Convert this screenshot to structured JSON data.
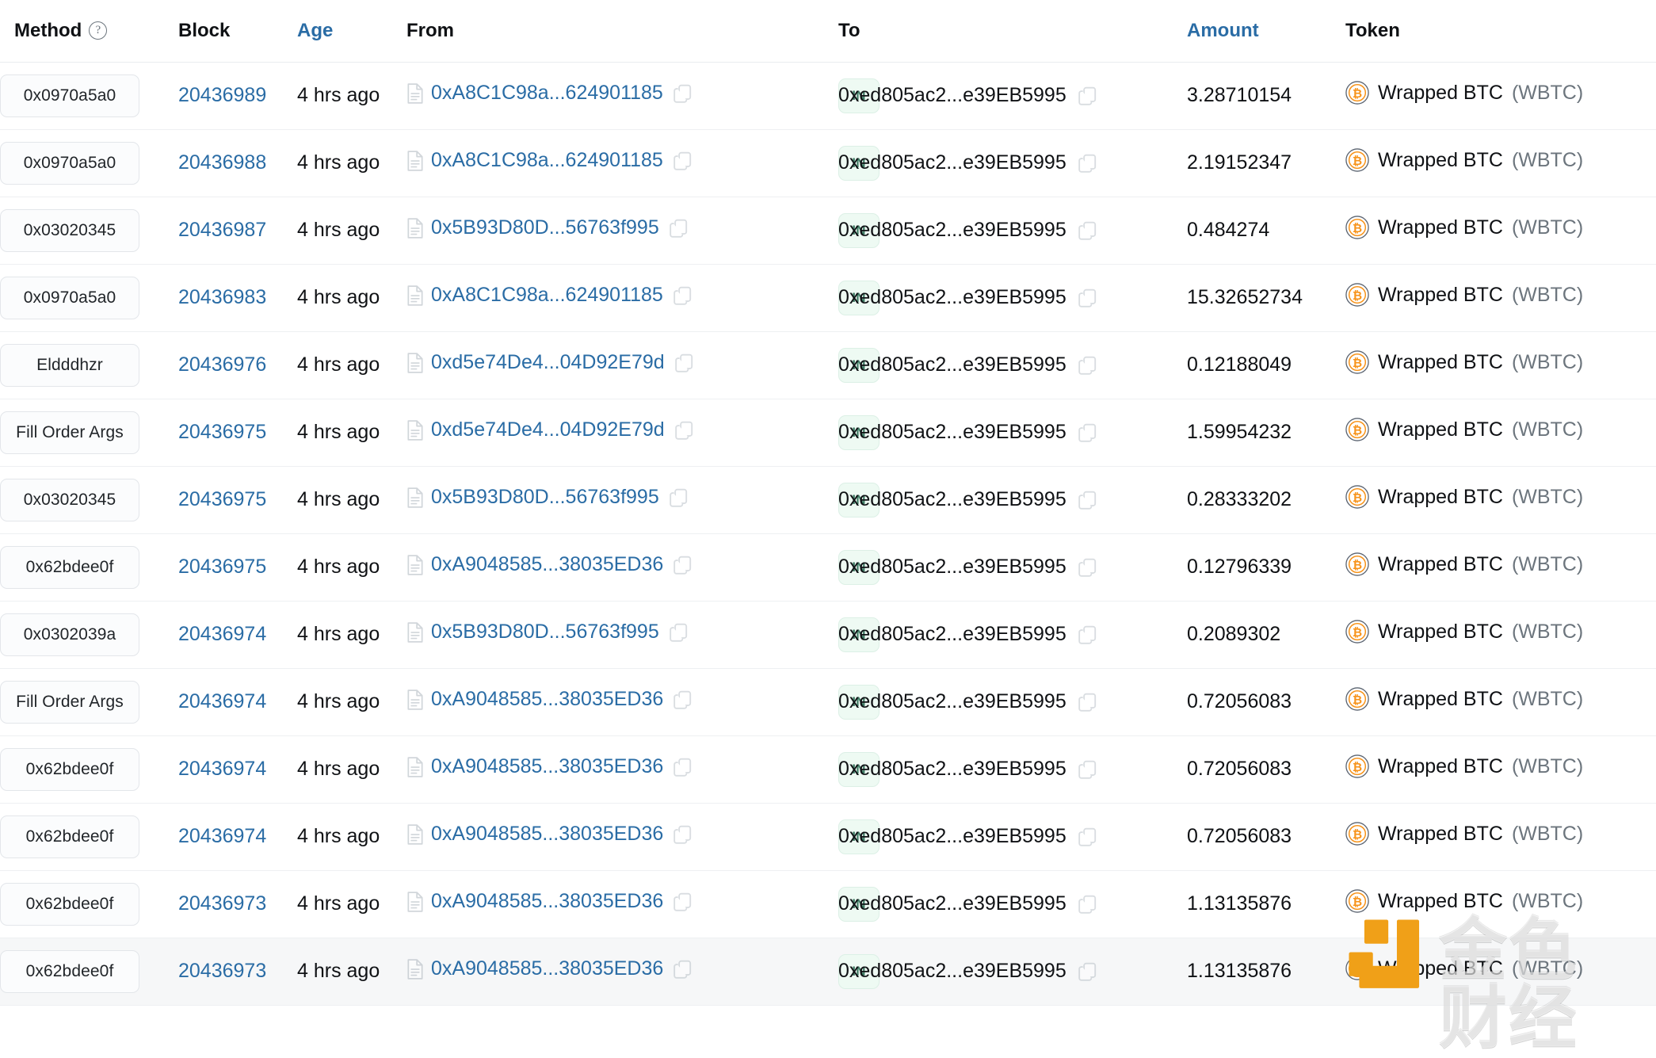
{
  "table": {
    "columns": [
      {
        "key": "method",
        "label": "Method",
        "sortable": false,
        "has_help_icon": true
      },
      {
        "key": "block",
        "label": "Block",
        "sortable": false
      },
      {
        "key": "age",
        "label": "Age",
        "sortable": true
      },
      {
        "key": "from",
        "label": "From",
        "sortable": false
      },
      {
        "key": "inout",
        "label": "",
        "sortable": false
      },
      {
        "key": "to",
        "label": "To",
        "sortable": false
      },
      {
        "key": "amount",
        "label": "Amount",
        "sortable": true
      },
      {
        "key": "token",
        "label": "Token",
        "sortable": false
      }
    ],
    "icons": {
      "help": "question-circle-icon",
      "from_doc": "document-icon",
      "copy": "copy-icon",
      "token": "wbtc-coin-icon"
    },
    "colors": {
      "link": "#2a6ca5",
      "header_text": "#0f1114",
      "sorted_header": "#2a6ca5",
      "in_badge_bg": "#eefaf3",
      "in_badge_text": "#3d7a63",
      "method_badge_bg": "#fbfcfd",
      "method_badge_border": "#e3e6ea",
      "row_border": "#eef0f2",
      "row_hover_bg": "#f6f7f8",
      "token_symbol": "#6c757d",
      "wbtc_orange": "#f7931a",
      "watermark_logo": "#f0a018"
    },
    "rows": [
      {
        "method": "0x0970a5a0",
        "block": "20436989",
        "age": "4 hrs ago",
        "from": "0xA8C1C98a...624901185",
        "direction": "IN",
        "to": "0xed805ac2...e39EB5995",
        "amount": "3.28710154",
        "token_name": "Wrapped BTC",
        "token_symbol": "(WBTC)",
        "hovered": false
      },
      {
        "method": "0x0970a5a0",
        "block": "20436988",
        "age": "4 hrs ago",
        "from": "0xA8C1C98a...624901185",
        "direction": "IN",
        "to": "0xed805ac2...e39EB5995",
        "amount": "2.19152347",
        "token_name": "Wrapped BTC",
        "token_symbol": "(WBTC)",
        "hovered": false
      },
      {
        "method": "0x03020345",
        "block": "20436987",
        "age": "4 hrs ago",
        "from": "0x5B93D80D...56763f995",
        "direction": "IN",
        "to": "0xed805ac2...e39EB5995",
        "amount": "0.484274",
        "token_name": "Wrapped BTC",
        "token_symbol": "(WBTC)",
        "hovered": false
      },
      {
        "method": "0x0970a5a0",
        "block": "20436983",
        "age": "4 hrs ago",
        "from": "0xA8C1C98a...624901185",
        "direction": "IN",
        "to": "0xed805ac2...e39EB5995",
        "amount": "15.32652734",
        "token_name": "Wrapped BTC",
        "token_symbol": "(WBTC)",
        "hovered": false
      },
      {
        "method": "Eldddhzr",
        "block": "20436976",
        "age": "4 hrs ago",
        "from": "0xd5e74De4...04D92E79d",
        "direction": "IN",
        "to": "0xed805ac2...e39EB5995",
        "amount": "0.12188049",
        "token_name": "Wrapped BTC",
        "token_symbol": "(WBTC)",
        "hovered": false
      },
      {
        "method": "Fill Order Args",
        "block": "20436975",
        "age": "4 hrs ago",
        "from": "0xd5e74De4...04D92E79d",
        "direction": "IN",
        "to": "0xed805ac2...e39EB5995",
        "amount": "1.59954232",
        "token_name": "Wrapped BTC",
        "token_symbol": "(WBTC)",
        "hovered": false
      },
      {
        "method": "0x03020345",
        "block": "20436975",
        "age": "4 hrs ago",
        "from": "0x5B93D80D...56763f995",
        "direction": "IN",
        "to": "0xed805ac2...e39EB5995",
        "amount": "0.28333202",
        "token_name": "Wrapped BTC",
        "token_symbol": "(WBTC)",
        "hovered": false
      },
      {
        "method": "0x62bdee0f",
        "block": "20436975",
        "age": "4 hrs ago",
        "from": "0xA9048585...38035ED36",
        "direction": "IN",
        "to": "0xed805ac2...e39EB5995",
        "amount": "0.12796339",
        "token_name": "Wrapped BTC",
        "token_symbol": "(WBTC)",
        "hovered": false
      },
      {
        "method": "0x0302039a",
        "block": "20436974",
        "age": "4 hrs ago",
        "from": "0x5B93D80D...56763f995",
        "direction": "IN",
        "to": "0xed805ac2...e39EB5995",
        "amount": "0.2089302",
        "token_name": "Wrapped BTC",
        "token_symbol": "(WBTC)",
        "hovered": false
      },
      {
        "method": "Fill Order Args",
        "block": "20436974",
        "age": "4 hrs ago",
        "from": "0xA9048585...38035ED36",
        "direction": "IN",
        "to": "0xed805ac2...e39EB5995",
        "amount": "0.72056083",
        "token_name": "Wrapped BTC",
        "token_symbol": "(WBTC)",
        "hovered": false
      },
      {
        "method": "0x62bdee0f",
        "block": "20436974",
        "age": "4 hrs ago",
        "from": "0xA9048585...38035ED36",
        "direction": "IN",
        "to": "0xed805ac2...e39EB5995",
        "amount": "0.72056083",
        "token_name": "Wrapped BTC",
        "token_symbol": "(WBTC)",
        "hovered": false
      },
      {
        "method": "0x62bdee0f",
        "block": "20436974",
        "age": "4 hrs ago",
        "from": "0xA9048585...38035ED36",
        "direction": "IN",
        "to": "0xed805ac2...e39EB5995",
        "amount": "0.72056083",
        "token_name": "Wrapped BTC",
        "token_symbol": "(WBTC)",
        "hovered": false
      },
      {
        "method": "0x62bdee0f",
        "block": "20436973",
        "age": "4 hrs ago",
        "from": "0xA9048585...38035ED36",
        "direction": "IN",
        "to": "0xed805ac2...e39EB5995",
        "amount": "1.13135876",
        "token_name": "Wrapped BTC",
        "token_symbol": "(WBTC)",
        "hovered": false
      },
      {
        "method": "0x62bdee0f",
        "block": "20436973",
        "age": "4 hrs ago",
        "from": "0xA9048585...38035ED36",
        "direction": "IN",
        "to": "0xed805ac2...e39EB5995",
        "amount": "1.13135876",
        "token_name": "Wrapped BTC",
        "token_symbol": "(WBTC)",
        "hovered": true
      }
    ]
  },
  "watermark": {
    "text": "金色财经",
    "logo_name": "jinse-finance-logo"
  }
}
